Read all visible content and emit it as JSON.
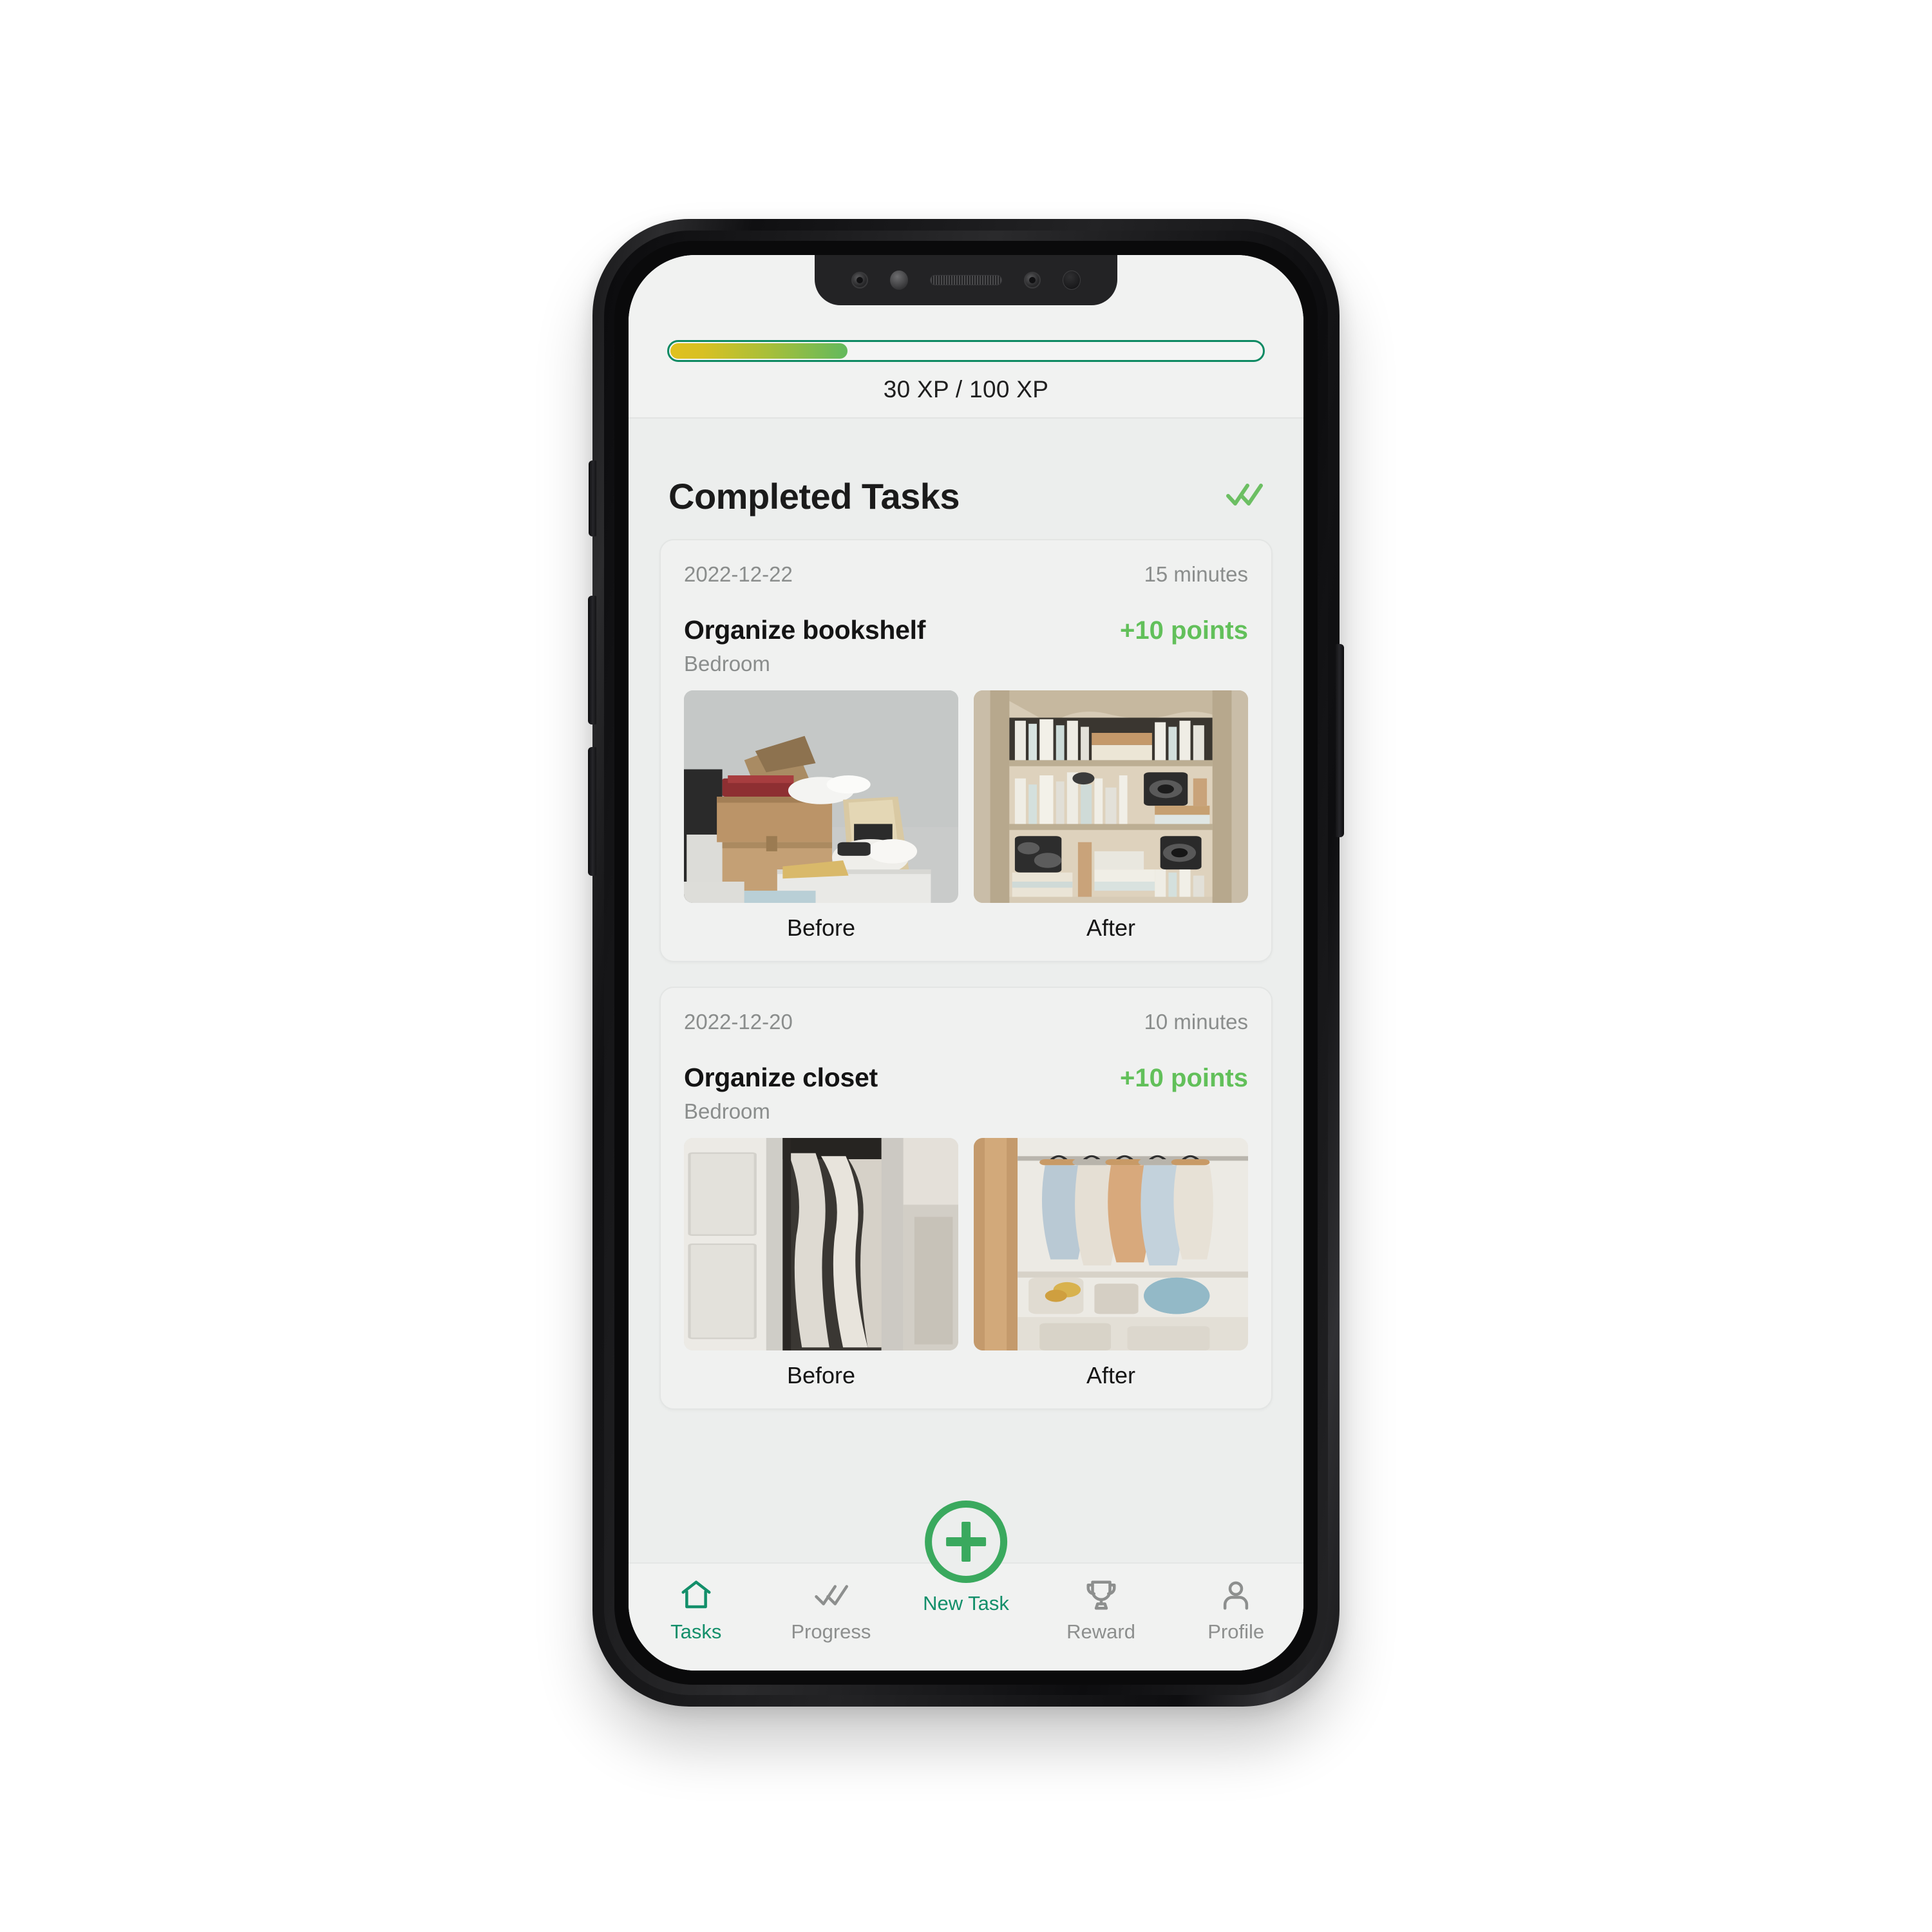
{
  "device": {
    "notch_items": [
      "sensor-icon",
      "front-camera-icon",
      "earpiece-speaker",
      "proximity-sensor-icon",
      "ir-camera-icon"
    ],
    "side_buttons": [
      "mute-switch",
      "volume-up-button",
      "volume-down-button",
      "power-button"
    ]
  },
  "xp": {
    "current": "30 XP",
    "total": "100 XP",
    "label": "30 XP / 100 XP",
    "percent": 30,
    "gradient_start": "#e0c11f",
    "gradient_end": "#63b95d",
    "track_border": "#0e8a63"
  },
  "header": {
    "title": "Completed Tasks",
    "check_icon": "double-check-icon",
    "check_color": "#6cbf63"
  },
  "tasks": [
    {
      "date": "2022-12-22",
      "duration": "15 minutes",
      "title": "Organize bookshelf",
      "points": "+10 points",
      "room": "Bedroom",
      "before_label": "Before",
      "after_label": "After",
      "before_alt": "cluttered cardboard boxes piled against a wall",
      "after_alt": "tidy wooden bookshelf filled with books and cameras"
    },
    {
      "date": "2022-12-20",
      "duration": "10 minutes",
      "title": "Organize closet",
      "points": "+10 points",
      "room": "Bedroom",
      "before_label": "Before",
      "after_label": "After",
      "before_alt": "messy closet with clothes spilling out of open doors",
      "after_alt": "neat open wardrobe with evenly hung garments"
    }
  ],
  "nav": {
    "items": [
      {
        "label": "Tasks",
        "icon": "home-icon",
        "active": true
      },
      {
        "label": "Progress",
        "icon": "double-check-icon",
        "active": false
      },
      {
        "label": "Reward",
        "icon": "trophy-icon",
        "active": false
      },
      {
        "label": "Profile",
        "icon": "person-icon",
        "active": false
      }
    ],
    "fab": {
      "label": "New Task",
      "icon": "plus-icon",
      "color": "#3aa95e"
    },
    "active_color": "#138f6a",
    "inactive_color": "#8d8f8e"
  }
}
